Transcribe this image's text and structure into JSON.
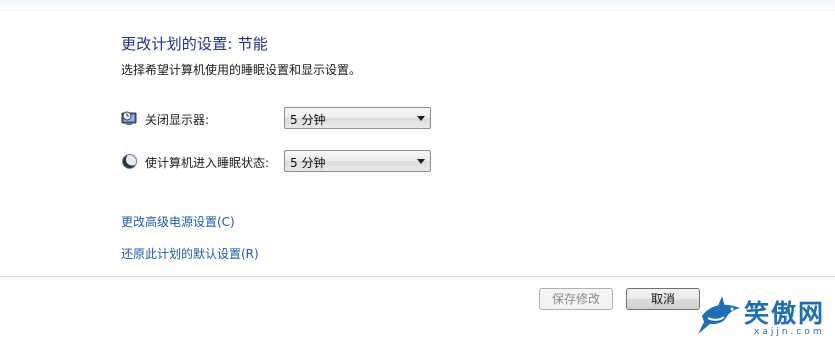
{
  "header": {
    "title": "更改计划的设置: 节能",
    "subtitle": "选择希望计算机使用的睡眠设置和显示设置。"
  },
  "settings": [
    {
      "icon": "monitor-clock-icon",
      "label": "关闭显示器:",
      "value": "5 分钟"
    },
    {
      "icon": "moon-sleep-icon",
      "label": "使计算机进入睡眠状态:",
      "value": "5 分钟"
    }
  ],
  "links": {
    "advanced": "更改高级电源设置(C)",
    "restore": "还原此计划的默认设置(R)"
  },
  "buttons": {
    "save": "保存修改",
    "cancel": "取消"
  },
  "watermark": {
    "text": "笑傲网",
    "domain": "xajjn.com"
  },
  "colors": {
    "title": "#1e3287",
    "link": "#1e5fa8",
    "watermark": "#1d6fb8"
  }
}
